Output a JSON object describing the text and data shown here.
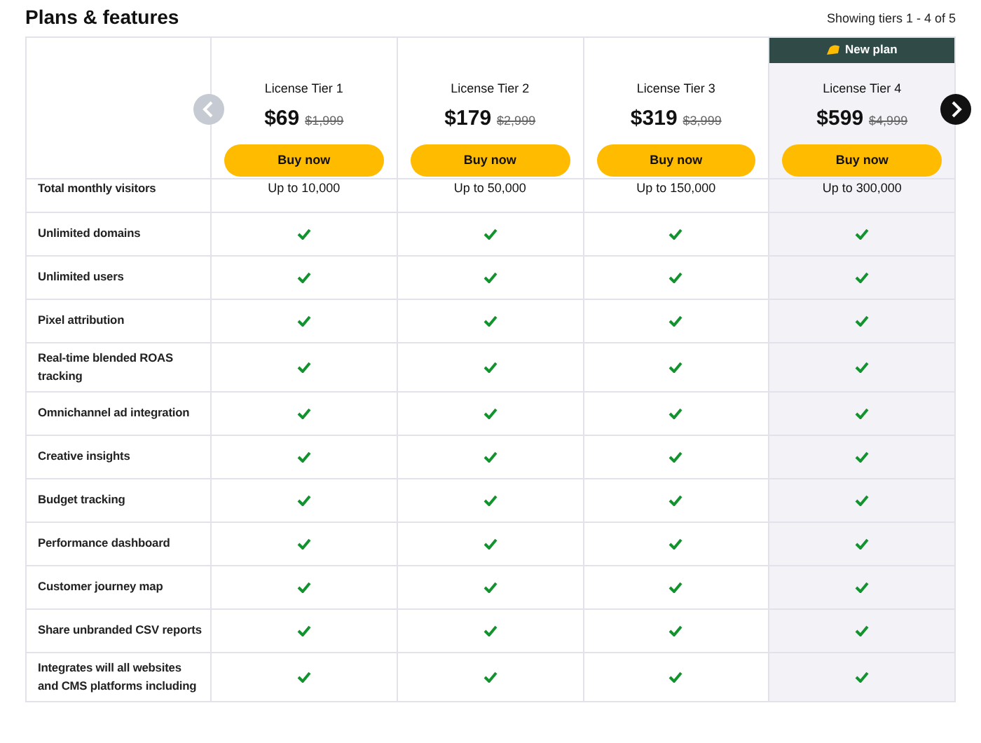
{
  "title": "Plans & features",
  "showing": "Showing tiers 1 - 4 of 5",
  "tiers": [
    {
      "name": "License Tier 1",
      "price": "$69",
      "old_price": "$1,999",
      "button": "Buy now",
      "highlighted": false
    },
    {
      "name": "License Tier 2",
      "price": "$179",
      "old_price": "$2,999",
      "button": "Buy now",
      "highlighted": false
    },
    {
      "name": "License Tier 3",
      "price": "$319",
      "old_price": "$3,999",
      "button": "Buy now",
      "highlighted": false
    },
    {
      "name": "License Tier 4",
      "price": "$599",
      "old_price": "$4,999",
      "button": "Buy now",
      "highlighted": true,
      "badge": "New plan"
    }
  ],
  "features": [
    {
      "label": "Total monthly visitors",
      "kind": "text",
      "values": [
        "Up to 10,000",
        "Up to 50,000",
        "Up to 150,000",
        "Up to 300,000"
      ]
    },
    {
      "label": "Unlimited domains",
      "kind": "check",
      "included": [
        true,
        true,
        true,
        true
      ]
    },
    {
      "label": "Unlimited users",
      "kind": "check",
      "included": [
        true,
        true,
        true,
        true
      ]
    },
    {
      "label": "Pixel attribution",
      "kind": "check",
      "included": [
        true,
        true,
        true,
        true
      ]
    },
    {
      "label": "Real-time blended ROAS tracking",
      "kind": "check",
      "included": [
        true,
        true,
        true,
        true
      ]
    },
    {
      "label": "Omnichannel ad integration",
      "kind": "check",
      "included": [
        true,
        true,
        true,
        true
      ]
    },
    {
      "label": "Creative insights",
      "kind": "check",
      "included": [
        true,
        true,
        true,
        true
      ]
    },
    {
      "label": "Budget tracking",
      "kind": "check",
      "included": [
        true,
        true,
        true,
        true
      ]
    },
    {
      "label": "Performance dashboard",
      "kind": "check",
      "included": [
        true,
        true,
        true,
        true
      ]
    },
    {
      "label": "Customer journey map",
      "kind": "check",
      "included": [
        true,
        true,
        true,
        true
      ]
    },
    {
      "label": "Share unbranded CSV reports",
      "kind": "check",
      "included": [
        true,
        true,
        true,
        true
      ]
    },
    {
      "label": "Integrates will all websites and CMS platforms including",
      "kind": "check",
      "included": [
        true,
        true,
        true,
        true
      ]
    }
  ]
}
